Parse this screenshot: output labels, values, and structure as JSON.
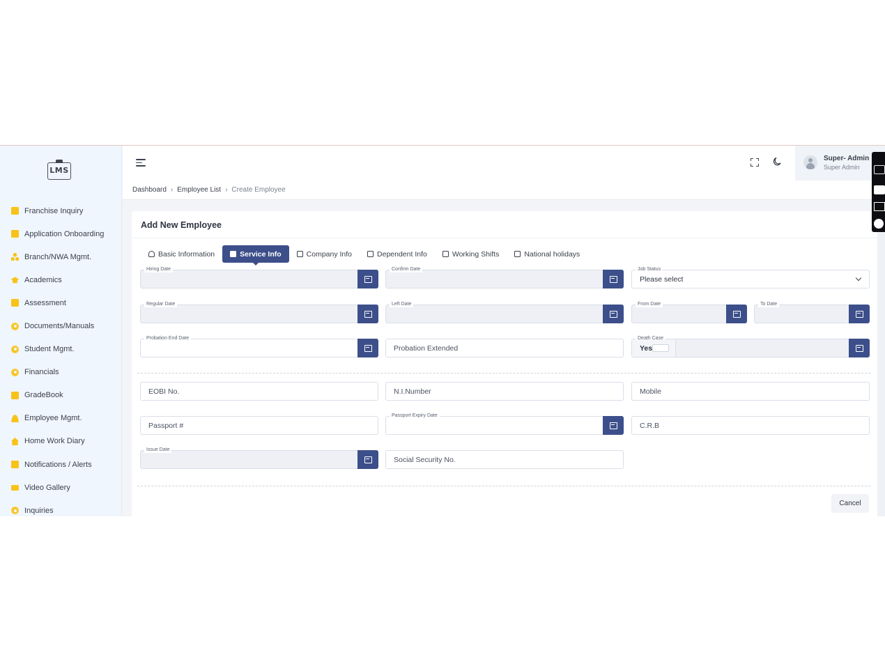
{
  "logo": {
    "text": "LMS"
  },
  "sidebar": {
    "items": [
      {
        "label": "Franchise Inquiry",
        "icon": "clipboard-icon"
      },
      {
        "label": "Application Onboarding",
        "icon": "file-icon"
      },
      {
        "label": "Branch/NWA Mgmt.",
        "icon": "sitemap-icon"
      },
      {
        "label": "Academics",
        "icon": "graduation-cap-icon"
      },
      {
        "label": "Assessment",
        "icon": "file-icon"
      },
      {
        "label": "Documents/Manuals",
        "icon": "gear-icon"
      },
      {
        "label": "Student Mgmt.",
        "icon": "gear-icon"
      },
      {
        "label": "Financials",
        "icon": "gear-icon"
      },
      {
        "label": "GradeBook",
        "icon": "book-icon"
      },
      {
        "label": "Employee Mgmt.",
        "icon": "user-icon"
      },
      {
        "label": "Home Work Diary",
        "icon": "home-icon"
      },
      {
        "label": "Notifications / Alerts",
        "icon": "bell-icon"
      },
      {
        "label": "Video Gallery",
        "icon": "video-icon"
      },
      {
        "label": "Inquiries",
        "icon": "gear-icon"
      }
    ]
  },
  "header": {
    "user_name": "Super- Admin",
    "user_role": "Super Admin"
  },
  "breadcrumb": {
    "items": [
      "Dashboard",
      "Employee List"
    ],
    "current": "Create Employee"
  },
  "card": {
    "title": "Add New Employee"
  },
  "tabs": [
    {
      "label": "Basic Information",
      "icon": "user-icon",
      "active": false
    },
    {
      "label": "Service Info",
      "icon": "briefcase-icon",
      "active": true
    },
    {
      "label": "Company Info",
      "icon": "home-icon",
      "active": false
    },
    {
      "label": "Dependent Info",
      "icon": "sitemap-icon",
      "active": false
    },
    {
      "label": "Working Shifts",
      "icon": "briefcase-icon",
      "active": false
    },
    {
      "label": "National holidays",
      "icon": "briefcase-icon",
      "active": false
    }
  ],
  "form": {
    "hiring_date": {
      "label": "Hiring Date",
      "value": ""
    },
    "confirm_date": {
      "label": "Confirm Date",
      "value": ""
    },
    "job_status": {
      "label": "Job Status",
      "value": "Please select"
    },
    "regular_date": {
      "label": "Regular Date",
      "value": ""
    },
    "left_date": {
      "label": "Left Date",
      "value": ""
    },
    "from_date": {
      "label": "From Date",
      "value": ""
    },
    "to_date": {
      "label": "To Date",
      "value": ""
    },
    "probation_end_date": {
      "label": "Probation End Date",
      "value": ""
    },
    "probation_extended": {
      "placeholder": "Probation Extended"
    },
    "death_case": {
      "label": "Death Case",
      "toggle_label": "Yes"
    },
    "eobi_no": {
      "placeholder": "EOBI No."
    },
    "ni_number": {
      "placeholder": "N.I.Number"
    },
    "mobile": {
      "placeholder": "Mobile"
    },
    "passport": {
      "placeholder": "Passport #"
    },
    "passport_expiry_date": {
      "label": "Passport Expiry Date",
      "value": ""
    },
    "crb": {
      "placeholder": "C.R.B"
    },
    "issue_date": {
      "label": "Issue Date",
      "value": ""
    },
    "social_security_no": {
      "placeholder": "Social Security No."
    }
  },
  "actions": {
    "cancel_label": "Cancel"
  },
  "colors": {
    "primary": "#3d4f8a",
    "sidebar_bg": "#f0f6fd",
    "accent_icon": "#f7c31a",
    "disabled_field": "#eef0f5"
  }
}
